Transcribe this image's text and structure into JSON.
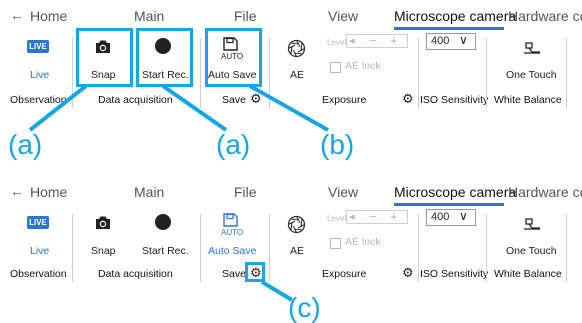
{
  "panels": [
    {
      "tabs": {
        "back_arrow": "←",
        "home": "Home",
        "main": "Main",
        "file": "File",
        "view": "View",
        "microscope_camera": "Microscope camera",
        "hardware": "Hardware co"
      },
      "buttons": {
        "live_badge": "LIVE",
        "live": "Live",
        "snap": "Snap",
        "start_rec": "Start Rec.",
        "auto_badge": "AUTO",
        "auto_save": "Auto Save",
        "ae": "AE",
        "level": "Level",
        "level_minus": "−",
        "level_plus": "+",
        "ae_lock": "AE lock",
        "iso_value": "400",
        "one_touch": "One Touch"
      },
      "groups": {
        "observation": "Observation",
        "data_acquisition": "Data acquisition",
        "save": "Save",
        "exposure": "Exposure",
        "iso_sensitivity": "ISO Sensitivity",
        "white_balance": "White Balance"
      }
    },
    {
      "tabs": {
        "back_arrow": "←",
        "home": "Home",
        "main": "Main",
        "file": "File",
        "view": "View",
        "microscope_camera": "Microscope camera",
        "hardware": "Hardware co"
      },
      "buttons": {
        "live_badge": "LIVE",
        "live": "Live",
        "snap": "Snap",
        "start_rec": "Start Rec.",
        "auto_badge": "AUTO",
        "auto_save": "Auto Save",
        "ae": "AE",
        "level": "Level",
        "level_minus": "−",
        "level_plus": "+",
        "ae_lock": "AE lock",
        "iso_value": "400",
        "one_touch": "One Touch"
      },
      "groups": {
        "observation": "Observation",
        "data_acquisition": "Data acquisition",
        "save": "Save",
        "exposure": "Exposure",
        "iso_sensitivity": "ISO Sensitivity",
        "white_balance": "White Balance"
      }
    }
  ],
  "callouts": {
    "a1": "(a)",
    "a2": "(a)",
    "b": "(b)",
    "c": "(c)"
  },
  "colors": {
    "highlight": "#14a6e6",
    "accent": "#2b76d6"
  }
}
